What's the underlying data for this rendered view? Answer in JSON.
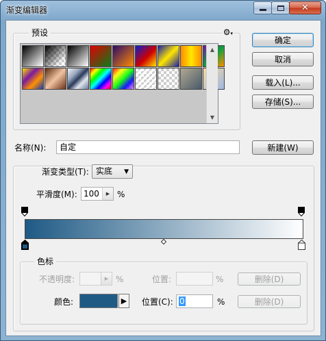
{
  "window": {
    "title": "渐变编辑器"
  },
  "presets": {
    "group_label": "预设",
    "menu_icon": "gear-icon",
    "swatches": [
      {
        "name": "black-white"
      },
      {
        "name": "black-transparent"
      },
      {
        "name": "black-white-reverse"
      },
      {
        "name": "red-green"
      },
      {
        "name": "violet-orange"
      },
      {
        "name": "blue-red-yellow"
      },
      {
        "name": "blue-yellow-blue"
      },
      {
        "name": "orange-yellow-orange"
      },
      {
        "name": "violet-green-orange"
      },
      {
        "name": "yellow-violet-orange-blue"
      },
      {
        "name": "copper"
      },
      {
        "name": "chrome"
      },
      {
        "name": "spectrum"
      },
      {
        "name": "transparent-rainbow"
      },
      {
        "name": "transparent-stripes"
      },
      {
        "name": "checker"
      },
      {
        "name": "gray-fade"
      },
      {
        "name": "pastel"
      }
    ]
  },
  "buttons": {
    "ok": "确定",
    "cancel": "取消",
    "load": "载入(L)...",
    "save": "存储(S)...",
    "new": "新建(W)"
  },
  "name_field": {
    "label": "名称(N):",
    "value": "自定"
  },
  "gradient_type": {
    "label": "渐变类型(T):",
    "value": "实底"
  },
  "smoothness": {
    "label": "平滑度(M):",
    "value": "100",
    "unit": "%"
  },
  "gradient": {
    "start_color": "#1f5a85",
    "end_color": "#ffffff"
  },
  "color_stops": {
    "group_label": "色标",
    "opacity_label": "不透明度:",
    "opacity_value": "",
    "opacity_unit": "%",
    "opacity_location_label": "位置:",
    "opacity_location_value": "",
    "opacity_location_unit": "%",
    "opacity_delete": "删除(D)",
    "color_label": "颜色:",
    "color_value": "#1f5a85",
    "color_location_label": "位置(C):",
    "color_location_value": "0",
    "color_location_unit": "%",
    "color_delete": "删除(D)"
  }
}
